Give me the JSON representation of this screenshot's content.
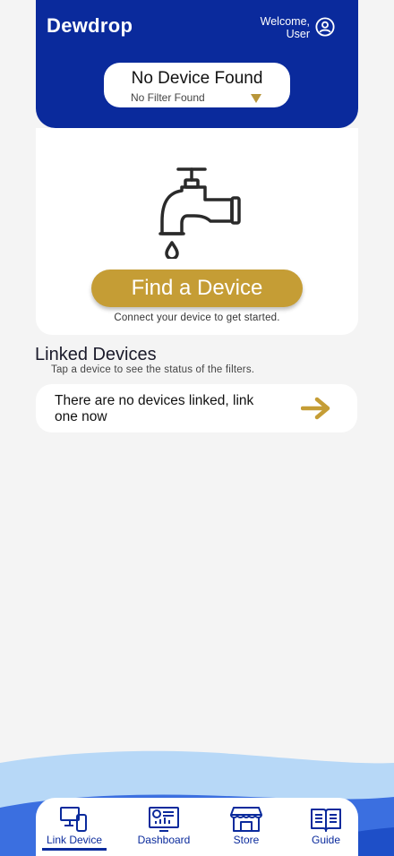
{
  "app": {
    "name": "Dewdrop"
  },
  "header": {
    "welcome": "Welcome, User",
    "user_icon": "user-circle-icon"
  },
  "device_selector": {
    "title": "No Device Found",
    "subtitle": "No Filter Found",
    "caret_icon": "triangle-down-icon"
  },
  "find_card": {
    "icon": "faucet-icon",
    "button_label": "Find a Device",
    "hint": "Connect your device to get started."
  },
  "linked": {
    "title": "Linked Devices",
    "subtitle": "Tap a device to see the status of the filters.",
    "empty_text": "There are no devices linked, link one now",
    "arrow_icon": "arrow-right-icon"
  },
  "tabs": [
    {
      "label": "Link Device",
      "icon": "devices-icon",
      "active": true
    },
    {
      "label": "Dashboard",
      "icon": "dashboard-monitor-icon",
      "active": false
    },
    {
      "label": "Store",
      "icon": "storefront-icon",
      "active": false
    },
    {
      "label": "Guide",
      "icon": "open-book-icon",
      "active": false
    }
  ],
  "colors": {
    "primary": "#0a2a9c",
    "accent": "#c59d35",
    "background": "#f4f4f4",
    "wave_light": "#b7d8f7",
    "wave_mid": "#3b6fe0"
  }
}
